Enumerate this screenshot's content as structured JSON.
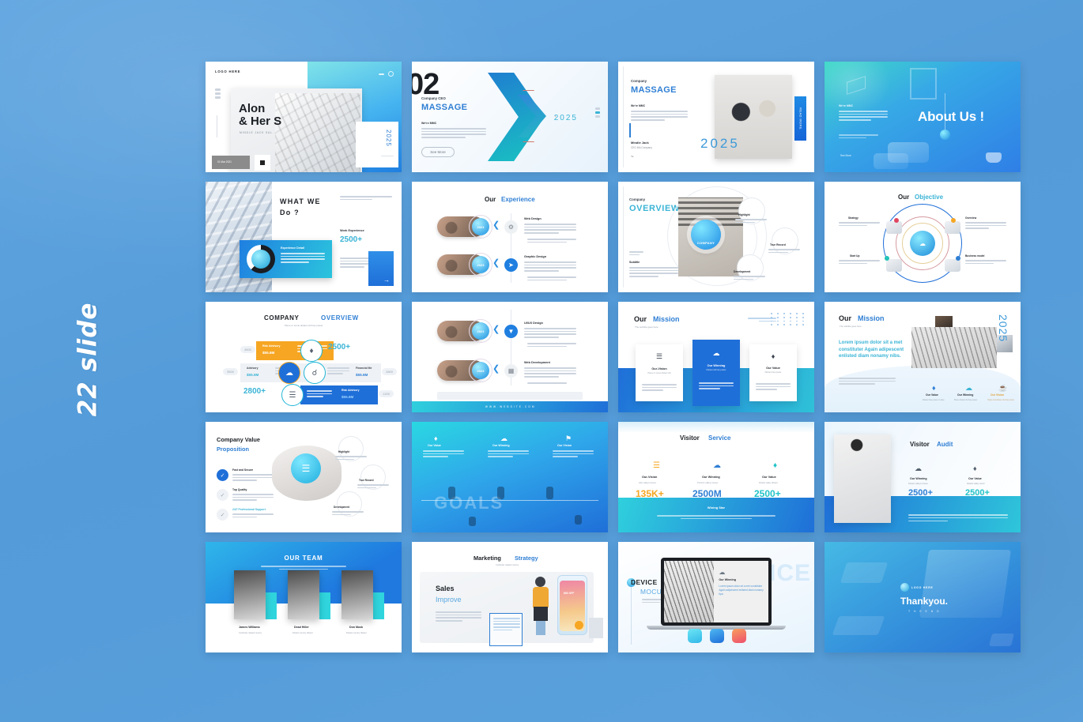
{
  "poster": {
    "side_label": "22 slide",
    "background_color": "#59a0dd",
    "accent_blue": "#1f6fd8",
    "accent_cyan": "#22b6d6",
    "accent_orange": "#f6a623"
  },
  "slides": [
    {
      "n": 1,
      "name": "cover-slide",
      "logo": "LOGO HERE",
      "title_line1": "Alon",
      "title_line2": "& Her S",
      "subtitle": "MINDLE  JACK   SAL...",
      "year": "2025",
      "button": "01 Mar 2021"
    },
    {
      "n": 2,
      "name": "company-ceo-slide",
      "number": "02",
      "eyebrow": "Company CEO",
      "title": "MASSAGE",
      "kicker": "We're MMC",
      "body": "A piece or even distant old has power to raise and gratify our thoughts this a return of special issues, or a valley portions, or a passage from the greatite poets. It always does one good.",
      "button": "See More",
      "year": "2025"
    },
    {
      "n": 3,
      "name": "company-massage-slide",
      "eyebrow": "Company",
      "title": "MASSAGE",
      "kicker": "We're MMC",
      "body": "A piece or even distant old has power to raise and gratify our thoughts this a return of special issues, or a valley portions, or a passage from the greatite poets. It always does one good.",
      "year": "2025",
      "person_name": "Mindle Jack",
      "person_role": "CEO MA Company",
      "tab_label": "READ MORE"
    },
    {
      "n": 4,
      "name": "about-us-slide",
      "title": "About Us !",
      "kicker": "We're MMC",
      "body": "A piece or even distant old has power to raise and gratify our thoughts this a return of special issues, or a valley portions.",
      "body2": "A piece or even distant old has power to raise and gratify our thoughts.",
      "link": "See More"
    },
    {
      "n": 5,
      "name": "what-we-do-slide",
      "title_line1": "WHAT WE",
      "title_line2": "Do ?",
      "top_note": "Piece of some distant old has power to raise and gratify our thoughts like a return this.",
      "stat_label": "Work Experience",
      "stat_value": "2500+",
      "card_title": "Experience Detail",
      "card_body": "A piece or even distant old has power to raise and gratify our thoughts this a return of special issues."
    },
    {
      "n": 6,
      "name": "our-experience-slide",
      "title_a": "Our ",
      "title_b": "Experience",
      "items": [
        {
          "label": "Web Design",
          "badge": "2021",
          "body": "A piece or even distant old has power to raise and gratify our thoughts this a return of special issues, or a valley portions."
        },
        {
          "label": "Graphic Design",
          "badge": "2023",
          "body": "A piece or even distant old has power to raise and gratify our thoughts this a return of special issues, or a valley portions."
        }
      ]
    },
    {
      "n": 7,
      "name": "company-overview-circle-slide",
      "eyebrow": "Company",
      "title": "OVERVIEW",
      "subtitle_label": "Subtitle",
      "subtitle_body": "A piece or even distant old has power to raise and gratify our thoughts this a return of special issues.",
      "core_label": "COMPANY",
      "nodes": [
        {
          "label": "Highlight",
          "body": "A piece or some distant old has power."
        },
        {
          "label": "True Record",
          "body": "A piece or some distant old has power."
        },
        {
          "label": "Development",
          "body": "A piece or some distant old has power."
        }
      ]
    },
    {
      "n": 8,
      "name": "our-objective-slide",
      "title_a": "Our ",
      "title_b": "Objective",
      "nodes": [
        {
          "label": "Strategy",
          "body": "Raise and gratify our thoughts like a return of special issues."
        },
        {
          "label": "Overview",
          "body": "Power to raise and gratify our thoughts like a stream of special issues."
        },
        {
          "label": "Start Up",
          "body": "A piece of some distant old has power to raise."
        },
        {
          "label": "Business model",
          "body": "A piece of some distant old has the power to raise and gratify."
        }
      ]
    },
    {
      "n": 9,
      "name": "company-overview-bars-slide",
      "title_a": "COMPANY ",
      "title_b": "OVERVIEW",
      "subtitle": "Piece or some distant old has power",
      "row1_label": "Risk Advisory",
      "row1_value": "$55.6M",
      "row1_body": "A piece or some distant old has power to raise.",
      "row1_stat": "2500+",
      "row2_label": "Advisory",
      "row2_value": "$55.6M",
      "row2_body": "A piece or some distant old has power to raise.",
      "row2_right_label": "Financial Me",
      "row2_right_value": "$55.6M",
      "row3_stat": "2800+",
      "row3_body": "A piece or some distant old has power to raise.",
      "row3_label": "Risk Advisory",
      "row3_value": "$55.6M"
    },
    {
      "n": 10,
      "name": "uiux-web-development-slide",
      "items": [
        {
          "label": "UI/UX Design",
          "badge": "2021",
          "body": "A piece or even distant old has power to raise and gratify our thoughts this a return of special issues, or a valley portions."
        },
        {
          "label": "Web Development",
          "badge": "2023",
          "body": "A piece or even distant old has power to raise and gratify our thoughts this a return of special issues, or a valley portions."
        }
      ],
      "footer": "W W W . W E B S I T E . C O M"
    },
    {
      "n": 11,
      "name": "our-mission-cards-slide",
      "title_a": "Our ",
      "title_b": "Mission",
      "subtitle": "The subtitle goes here",
      "note": "Piece or some distant old has power",
      "cards": [
        {
          "label": "Our-Vision",
          "sub": "Piece or some distant old",
          "body": "A piece or some distant old has power to raise and gratify our thought."
        },
        {
          "label": "Our Winning",
          "sub": "Distant old has power",
          "body": "A piece or some distant old has power to raise and gratify."
        },
        {
          "label": "Our Value",
          "sub": "Distant has power",
          "body": "A piece or some distant old has power to raise and gratify."
        }
      ]
    },
    {
      "n": 12,
      "name": "our-mission-lorem-slide",
      "title_a": "Our ",
      "title_b": "Mission",
      "subtitle": "The subtitle goes here",
      "lead": "Lorem ipsum dolor sit a met constituter Again adipescent enlisted diam nonamy nibs.",
      "body": "Piece or some distant old has power to raise and gratify our thoughts like a return of special issues, or a valley portion, or a passage from this.",
      "year": "2025",
      "items": [
        {
          "label": "Our Value",
          "sub": "Distant has power to raise"
        },
        {
          "label": "Our Winning",
          "sub": "Piece distant old has power"
        },
        {
          "label": "Our Vision",
          "sub": "Helps and distant old has power"
        }
      ]
    },
    {
      "n": 13,
      "name": "company-value-proposition-slide",
      "title_line1": "Company Value",
      "title_line2": "Proposition",
      "features": [
        {
          "label": "Fast and Secure",
          "body": "A piece or some distant old has power to raise and gratify our thoughts like a return of special issues, or a valley portion."
        },
        {
          "label": "Top Quality",
          "body": "A piece or some distant old has power to raise and gratify our thoughts like a stream of special issues, or a valley."
        },
        {
          "label": "24/7 Professional Support",
          "body": "A piece or some distant old has power to raise and gratify our thoughts."
        }
      ],
      "bubbles": [
        {
          "label": "Highlight",
          "body": "A piece or some distant old has power."
        },
        {
          "label": "True Record",
          "body": "A piece or some distant old has power."
        },
        {
          "label": "Development",
          "body": "A piece or some distant old has power."
        }
      ]
    },
    {
      "n": 14,
      "name": "goals-slide",
      "word": "GOALS",
      "columns": [
        {
          "label": "Our Value",
          "body": "A piece or some distant old has power to raise and gratify."
        },
        {
          "label": "Our Winning",
          "body": "A piece or some distant old has power to raise and gratify."
        },
        {
          "label": "Our Vision",
          "body": "A piece or some distant old has power to raise and gratify."
        }
      ]
    },
    {
      "n": 15,
      "name": "visitor-service-slide",
      "title_a": "Visitor ",
      "title_b": "Service",
      "stats": [
        {
          "label": "Our-Vision",
          "sub": "Also valleys issues",
          "value": "135K+",
          "color": "#f6a623"
        },
        {
          "label": "Our Winning",
          "sub": "Portions valleys issues",
          "value": "2500M",
          "color": "#1f6fd8"
        },
        {
          "label": "Our Value",
          "sub": "Distant valley distant",
          "value": "2500+",
          "color": "#22b6d6"
        }
      ],
      "footer_title": "Wining Star",
      "footer_body": "Piece or some distant old has power to raise and gratify our thoughts like a return of special issues or a valley portion."
    },
    {
      "n": 16,
      "name": "visitor-audit-slide",
      "title_a": "Visitor ",
      "title_b": "Audit",
      "stats": [
        {
          "label": "Our Winning",
          "sub": "Distant valleys issues",
          "value": "2500+",
          "color": "#1f6fd8"
        },
        {
          "label": "Our Value",
          "sub": "Distant valley return",
          "value": "2500+",
          "color": "#22b6d6"
        }
      ],
      "footer_body": "Piece or some distant old has power to raise and gratify our thoughts like a return of special issues, or a valley portion, or a passage from this."
    },
    {
      "n": 17,
      "name": "our-team-slide",
      "title": "OUR TEAM",
      "subtitle": "Piece or some distant old has power to raise and gratify our thoughts like a return of special issues.",
      "members": [
        {
          "name": "James Williams",
          "role": "Cordinate related country"
        },
        {
          "name": "Dead Hiller",
          "role": "Distant country distant"
        },
        {
          "name": "Don Musk",
          "role": "Distant country distant"
        }
      ]
    },
    {
      "n": 18,
      "name": "marketing-strategy-slide",
      "title_a": "Marketing ",
      "title_b": "Strategy",
      "subtitle": "Cordinate related country",
      "head_line1": "Sales",
      "head_line2": "Improve",
      "body": "A piece or some distant old has power to raise and gratify our thoughts like a return of special issues, or a valley portion, or a passage from the greatite poets.",
      "note": "Piece or some distant old has power to raise and gratify our thoughts like a stream of special issues.",
      "offer": "$90 OFF"
    },
    {
      "n": 19,
      "name": "device-mockup-slide",
      "title_line1": "DEVICE",
      "title_line2": "MOCUP",
      "subtitle": "Piece or some distant old has power to raise.",
      "ghost": "DEVICE",
      "screen_label": "Our Winning",
      "screen_body": "Lorem ipsum dolor sit a met constituter Again adipescent enlisted diam nonamy tipa."
    },
    {
      "n": 20,
      "name": "thankyou-slide",
      "logo": "LOGO HERE",
      "title": "Thankyou.",
      "subtitle": "T H E   E N D"
    }
  ]
}
